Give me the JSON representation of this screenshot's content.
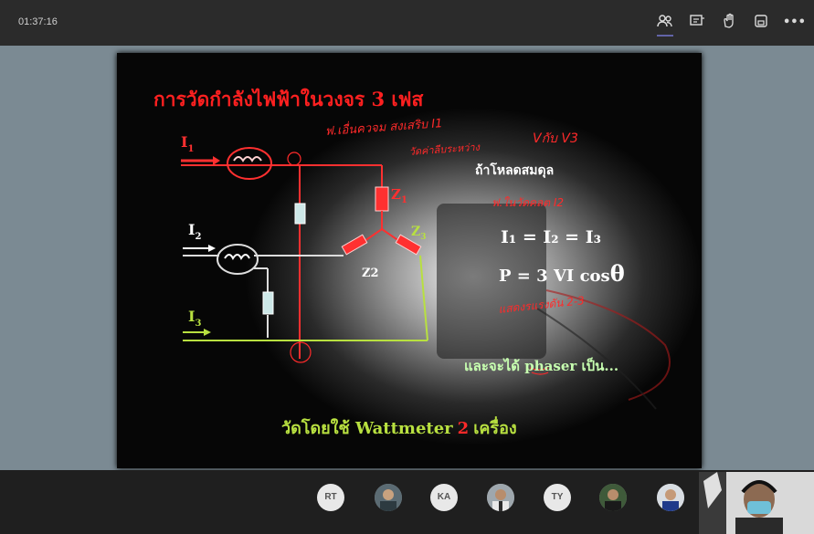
{
  "meeting": {
    "timer": "01:37:16",
    "toolbar": [
      {
        "icon": "participants-icon",
        "glyph": "👥"
      },
      {
        "icon": "chat-icon",
        "glyph": "🗨"
      },
      {
        "icon": "raise-hand-icon",
        "glyph": "✋"
      },
      {
        "icon": "share-tray-icon",
        "glyph": "⧉"
      },
      {
        "icon": "more-options-icon",
        "glyph": "•••"
      }
    ]
  },
  "slide": {
    "title": "การวัดกำลังไฟฟ้าในวงจร 3 เฟส",
    "labels": {
      "i1": "I",
      "i1_sub": "1",
      "i2": "I",
      "i2_sub": "2",
      "i3": "I",
      "i3_sub": "3",
      "z1": "Z",
      "z1_sub": "1",
      "z2": "Z2",
      "z3": "Z",
      "z3_sub": "3"
    },
    "balanced_load": "ถ้าโหลดสมดุล",
    "eq_currents": "I₁ = I₂ = I₃",
    "eq_power_prefix": "P = 3 VI cos",
    "eq_power_theta": "θ",
    "phaser_text": "และจะได้ phaser เป็น...",
    "footer_prefix": "วัดโดยใช้ Wattmeter",
    "footer_number": "2",
    "footer_suffix": "เครื่อง",
    "handwriting": [
      "ฟ.เอื่นควจม สงเสริบ I1",
      "วัดค่าลีบระหว่าง",
      "Vกับ V3",
      "ฟ.ในวัดคลต I2",
      "แสดงรแรงดัน 2-3"
    ]
  },
  "participants": [
    {
      "type": "initials",
      "text": "RT"
    },
    {
      "type": "photo",
      "text": ""
    },
    {
      "type": "initials",
      "text": "KA"
    },
    {
      "type": "photo",
      "text": ""
    },
    {
      "type": "initials",
      "text": "TY"
    },
    {
      "type": "photo",
      "text": ""
    },
    {
      "type": "photo",
      "text": ""
    }
  ]
}
